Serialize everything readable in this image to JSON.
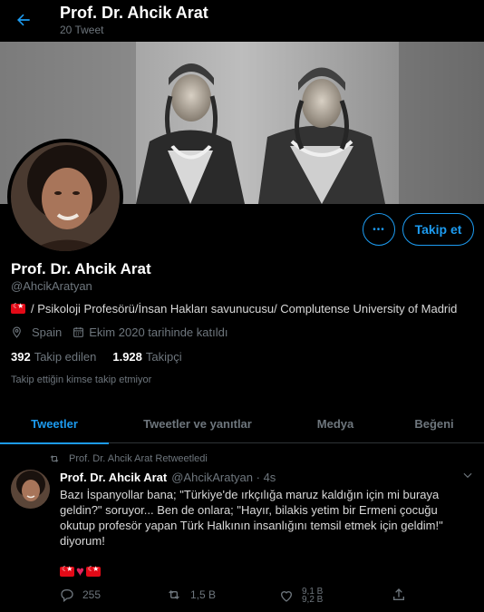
{
  "header": {
    "title": "Prof. Dr. Ahcik Arat",
    "subtitle": "20 Tweet"
  },
  "profile": {
    "name": "Prof. Dr. Ahcik Arat",
    "handle": "@AhcikAratyan",
    "bio": "/ Psikoloji Profesörü/İnsan Hakları savunucusu/ Complutense University of Madrid",
    "location": "Spain",
    "joined": "Ekim 2020 tarihinde katıldı",
    "following_count": "392",
    "following_label": "Takip edilen",
    "followers_count": "1.928",
    "followers_label": "Takipçi",
    "note": "Takip ettiğin kimse takip etmiyor",
    "follow_button": "Takip et",
    "more_button": "•••"
  },
  "tabs": [
    {
      "label": "Tweetler",
      "active": true
    },
    {
      "label": "Tweetler ve yanıtlar",
      "active": false
    },
    {
      "label": "Medya",
      "active": false
    },
    {
      "label": "Beğeni",
      "active": false
    }
  ],
  "tweet": {
    "retweet_note": "Prof. Dr. Ahcik Arat Retweetledi",
    "author_name": "Prof. Dr. Ahcik Arat",
    "author_handle_time": "@AhcikAratyan · 4s",
    "text": "Bazı İspanyollar bana; \"Türkiye'de ırkçılığa maruz kaldığın için mi buraya geldin?\" soruyor... Ben de onlara; \"Hayır, bilakis yetim bir Ermeni çocuğu okutup profesör yapan Türk Halkının insanlığını temsil etmek için geldim!\" diyorum!",
    "heart_glyph": "♥",
    "reply_count": "255",
    "retweet_count": "1,5 B",
    "like_count": "9,1 B",
    "like_count_next": "9,2 B"
  },
  "colors": {
    "accent": "#1d9bf0",
    "background": "#000000",
    "muted": "#6e767d",
    "flag_red": "#e30a17",
    "heart": "#e0245e"
  }
}
